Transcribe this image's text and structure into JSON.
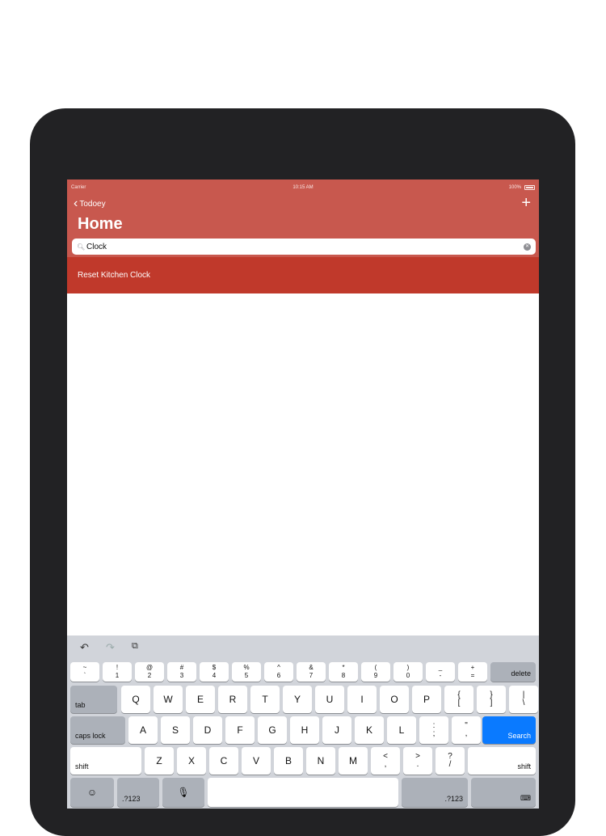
{
  "status_bar": {
    "carrier": "Carrier",
    "time": "10:15 AM",
    "battery": "100%"
  },
  "nav": {
    "back_label": "Todoey",
    "add_label": "+",
    "title": "Home"
  },
  "search": {
    "value": "Clock",
    "icon": "search-icon",
    "clear_icon": "clear-icon"
  },
  "results": [
    {
      "label": "Reset Kitchen Clock"
    }
  ],
  "colors": {
    "header": "#c8584e",
    "row": "#c0392b",
    "search_key": "#0a7aff"
  },
  "keyboard": {
    "shortcuts": {
      "undo": "↶",
      "redo": "↷",
      "paste": "⧉"
    },
    "number_row": [
      {
        "top": "~",
        "bottom": "`"
      },
      {
        "top": "!",
        "bottom": "1"
      },
      {
        "top": "@",
        "bottom": "2"
      },
      {
        "top": "#",
        "bottom": "3"
      },
      {
        "top": "$",
        "bottom": "4"
      },
      {
        "top": "%",
        "bottom": "5"
      },
      {
        "top": "^",
        "bottom": "6"
      },
      {
        "top": "&",
        "bottom": "7"
      },
      {
        "top": "*",
        "bottom": "8"
      },
      {
        "top": "(",
        "bottom": "9"
      },
      {
        "top": ")",
        "bottom": "0"
      },
      {
        "top": "_",
        "bottom": "-"
      },
      {
        "top": "+",
        "bottom": "="
      }
    ],
    "delete": "delete",
    "tab": "tab",
    "row1": [
      "Q",
      "W",
      "E",
      "R",
      "T",
      "Y",
      "U",
      "I",
      "O",
      "P"
    ],
    "row1_syms": [
      {
        "top": "{",
        "bottom": "["
      },
      {
        "top": "}",
        "bottom": "]"
      },
      {
        "top": "|",
        "bottom": "\\"
      }
    ],
    "caps_lock": "caps lock",
    "row2": [
      "A",
      "S",
      "D",
      "F",
      "G",
      "H",
      "J",
      "K",
      "L"
    ],
    "row2_syms": [
      {
        "top": ":",
        "bottom": ";"
      },
      {
        "top": "\"",
        "bottom": ","
      }
    ],
    "search": "Search",
    "shift": "shift",
    "row3": [
      "Z",
      "X",
      "C",
      "V",
      "B",
      "N",
      "M"
    ],
    "row3_syms": [
      {
        "top": "<",
        "bottom": ","
      },
      {
        "top": ">",
        "bottom": "."
      },
      {
        "top": "?",
        "bottom": "/"
      }
    ],
    "emoji": "☺",
    "numbers": ".?123",
    "mic": "🎙",
    "dismiss": "⌨"
  }
}
